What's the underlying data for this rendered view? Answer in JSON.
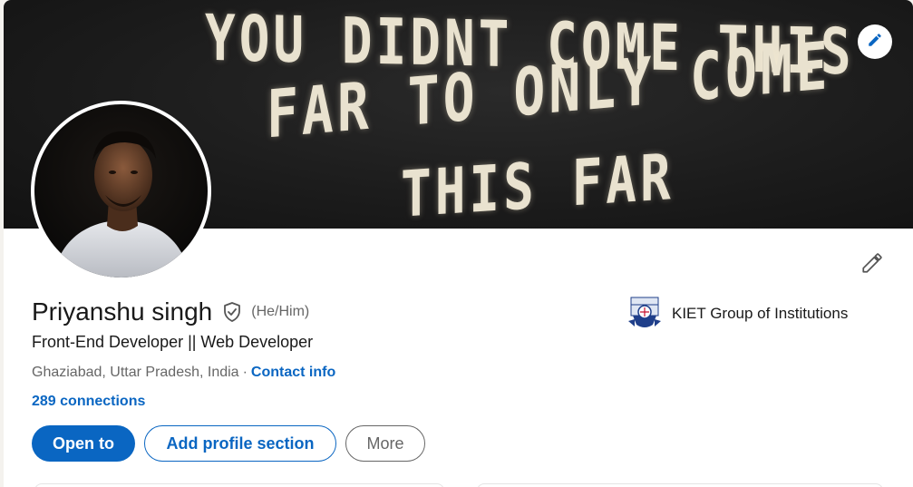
{
  "banner": {
    "line1": "YOU DIDNT COME THIS",
    "line2": "FAR TO ONLY COME",
    "line3": "THIS FAR",
    "edit_icon": "pencil-icon"
  },
  "profile": {
    "name": "Priyanshu singh",
    "verified_icon": "verified-shield-icon",
    "pronouns": "(He/Him)",
    "headline": "Front-End Developer || Web Developer",
    "location": "Ghaziabad, Uttar Pradesh, India",
    "separator": "·",
    "contact_label": "Contact info",
    "connections": "289 connections",
    "edit_icon": "pencil-icon"
  },
  "education": {
    "name": "KIET Group of Institutions",
    "logo_icon": "kiet-logo-icon"
  },
  "buttons": {
    "open_to": "Open to",
    "add_section": "Add profile section",
    "more": "More"
  },
  "colors": {
    "accent": "#0a66c2",
    "text": "#191919",
    "muted": "#666666"
  }
}
